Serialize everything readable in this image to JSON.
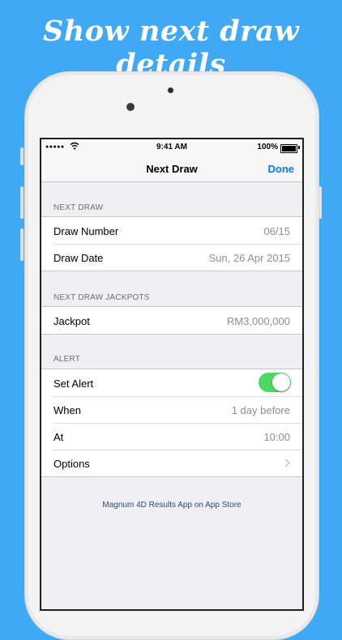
{
  "promo": {
    "title": "Show next draw details"
  },
  "status_bar": {
    "signal": "●●●●●",
    "time": "9:41 AM",
    "battery": "100%"
  },
  "nav": {
    "title": "Next Draw",
    "done_label": "Done"
  },
  "sections": {
    "next_draw": {
      "header": "NEXT DRAW",
      "rows": [
        {
          "label": "Draw Number",
          "value": "06/15"
        },
        {
          "label": "Draw Date",
          "value": "Sun, 26 Apr 2015"
        }
      ]
    },
    "jackpots": {
      "header": "NEXT DRAW JACKPOTS",
      "rows": [
        {
          "label": "Jackpot",
          "value": "RM3,000,000"
        }
      ]
    },
    "alert": {
      "header": "ALERT",
      "set_alert": {
        "label": "Set Alert",
        "enabled": true
      },
      "rows": [
        {
          "label": "When",
          "value": "1 day before"
        },
        {
          "label": "At",
          "value": "10:00"
        }
      ],
      "options": {
        "label": "Options",
        "icon": "chevron-right-icon"
      }
    }
  },
  "footer": {
    "link": "Magnum 4D Results App on App Store"
  },
  "colors": {
    "background": "#3fa9f5",
    "accent": "#007aff",
    "switch_on": "#4cd964"
  }
}
